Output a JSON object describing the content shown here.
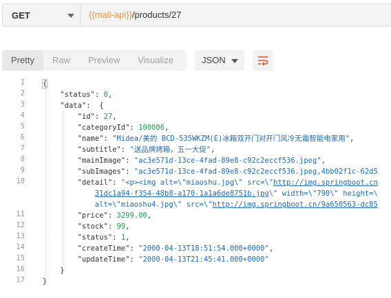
{
  "request": {
    "method": "GET",
    "url_var": "{{mall-api}}",
    "url_path": "/products/27"
  },
  "toolbar": {
    "tabs": [
      "Pretty",
      "Raw",
      "Preview",
      "Visualize"
    ],
    "active_tab": "Pretty",
    "format": "JSON"
  },
  "colors": {
    "key": "#333333",
    "string": "#1e6bb8",
    "number": "#1e9a4a",
    "url_variable": "#f29630",
    "wrap_icon": "#e8552f"
  },
  "code_lines": [
    {
      "n": "1",
      "text": "{"
    },
    {
      "n": "2",
      "key": "\"status\"",
      "num": "0",
      "tail": ","
    },
    {
      "n": "3",
      "key": "\"data\"",
      "tail": " {"
    },
    {
      "n": "4",
      "key": "\"id\"",
      "num": "27",
      "tail": ","
    },
    {
      "n": "5",
      "key": "\"categoryId\"",
      "num": "100006",
      "tail": ","
    },
    {
      "n": "6",
      "key": "\"name\"",
      "str": "\"Midea/美的 BCD-535WKZM(E)冰箱双开门对开门风冷无霜智能电家用\"",
      "tail": ","
    },
    {
      "n": "7",
      "key": "\"subtitle\"",
      "str": "\"送品牌烤箱，五一大促\"",
      "tail": ","
    },
    {
      "n": "8",
      "key": "\"mainImage\"",
      "str": "\"ac3e571d-13ce-4fad-89e8-c92c2eccf536.jpeg\"",
      "tail": ","
    },
    {
      "n": "9",
      "key": "\"subImages\"",
      "str": "\"ac3e571d-13ce-4fad-89e8-c92c2eccf536.jpeg,4bb02f1c-62d5",
      "tail": ""
    },
    {
      "n": "10",
      "key": "\"detail\"",
      "str": "\"<p><img alt=\\\"miaoshu.jpg\\\" src=\\\"",
      "url": "http://img.springboot.cn",
      "tail": ""
    },
    {
      "n": "",
      "indent": 4,
      "url": "31dc1a94-f354-48b8-a170-1a1a6de8751b.jpg",
      "str2": "\\\" width=\\\"790\\\" height=\\",
      "tail": ""
    },
    {
      "n": "",
      "indent": 4,
      "str": "alt=\\\"miaoshu4.jpg\\\" src=\\\"",
      "url": "http://img.springboot.cn/9a650563-dc85",
      "tail": ""
    },
    {
      "n": "11",
      "key": "\"price\"",
      "num": "3299.00",
      "tail": ","
    },
    {
      "n": "12",
      "key": "\"stock\"",
      "num": "99",
      "tail": ","
    },
    {
      "n": "13",
      "key": "\"status\"",
      "num": "1",
      "tail": ","
    },
    {
      "n": "14",
      "key": "\"createTime\"",
      "str": "\"2000-04-13T18:51:54.000+0000\"",
      "tail": ","
    },
    {
      "n": "15",
      "key": "\"updateTime\"",
      "str": "\"2000-04-13T21:45:41.000+0000\"",
      "tail": ""
    },
    {
      "n": "16",
      "text": "    }"
    },
    {
      "n": "17",
      "text": "}"
    }
  ]
}
